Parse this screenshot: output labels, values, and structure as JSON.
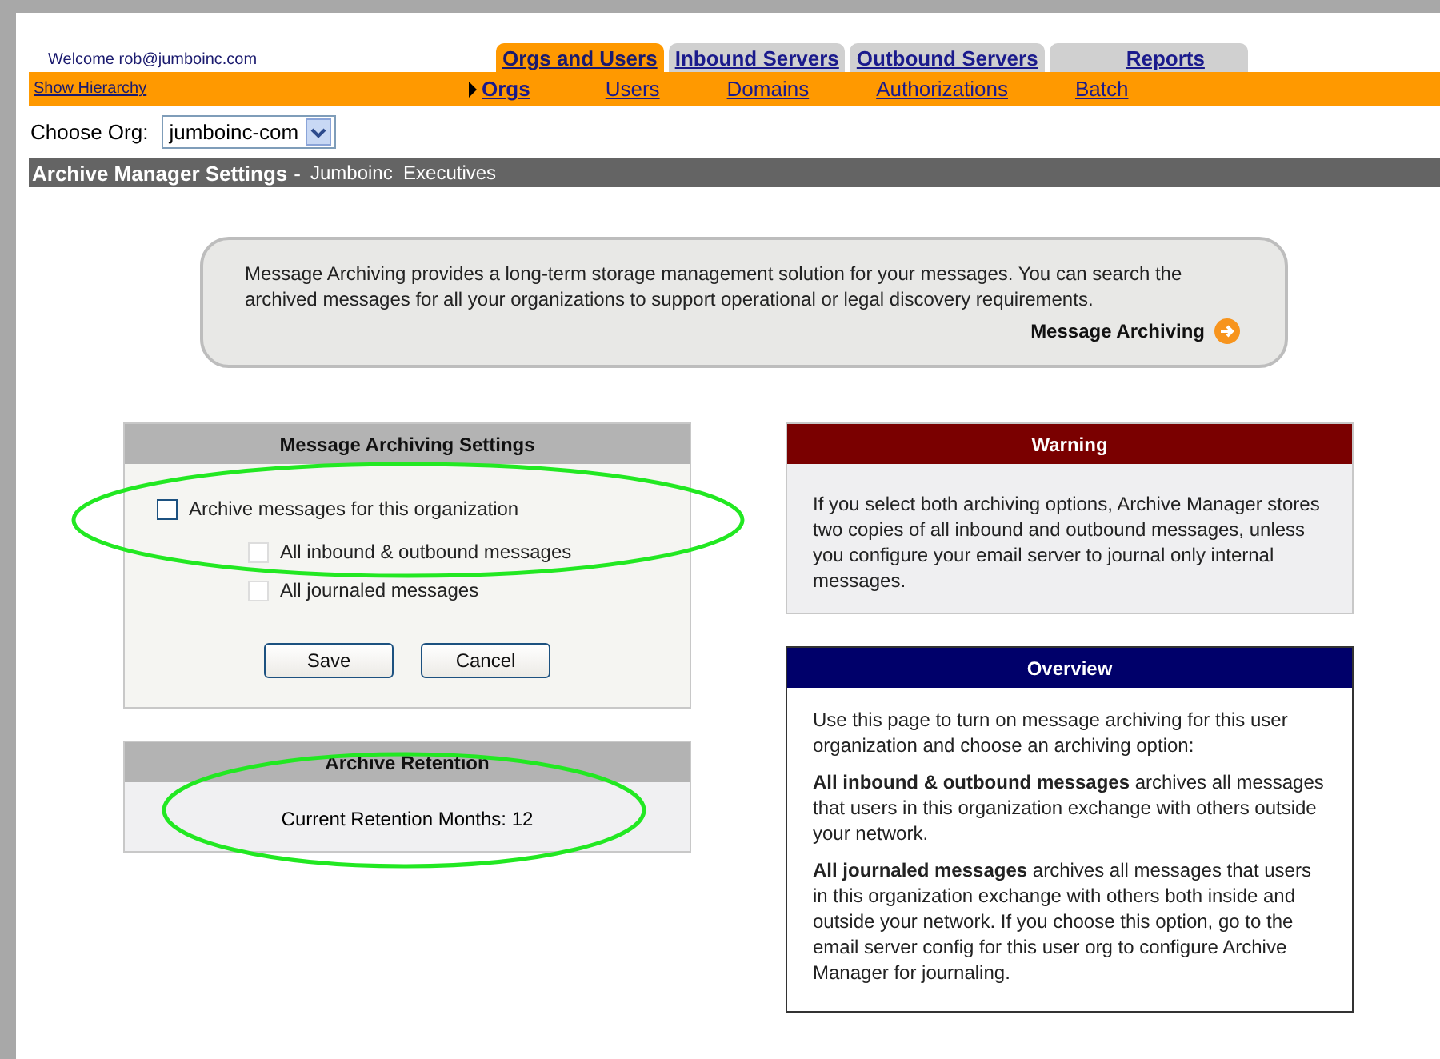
{
  "header": {
    "welcome": "Welcome rob@jumboinc.com",
    "show_hierarchy": "Show Hierarchy"
  },
  "tabs": [
    {
      "label": "Orgs and Users",
      "selected": true
    },
    {
      "label": "Inbound Servers",
      "selected": false
    },
    {
      "label": "Outbound Servers",
      "selected": false
    },
    {
      "label": "Reports",
      "selected": false
    }
  ],
  "subnav": [
    {
      "label": "Orgs",
      "selected": true
    },
    {
      "label": "Users",
      "selected": false
    },
    {
      "label": "Domains",
      "selected": false
    },
    {
      "label": "Authorizations",
      "selected": false
    },
    {
      "label": "Batch",
      "selected": false
    }
  ],
  "org_chooser": {
    "label": "Choose Org:",
    "value": "jumboinc-com"
  },
  "title_bar": {
    "title": "Archive Manager Settings",
    "separator": "-",
    "org": "Jumboinc  Executives"
  },
  "info": {
    "text": "Message Archiving provides a long-term storage management solution for your messages. You can search the archived messages for all your organizations to support operational or legal discovery requirements.",
    "link": "Message Archiving"
  },
  "settings": {
    "title": "Message Archiving Settings",
    "options": [
      {
        "label": "Archive messages for this organization",
        "checked": false,
        "disabled": false,
        "children": [
          {
            "label": "All inbound & outbound messages",
            "checked": false,
            "disabled": true
          },
          {
            "label": "All journaled messages",
            "checked": false,
            "disabled": true
          }
        ]
      }
    ],
    "buttons": [
      "Save",
      "Cancel"
    ]
  },
  "retention": {
    "title": "Archive Retention",
    "text": "Current Retention Months: 12"
  },
  "warning": {
    "title": "Warning",
    "text": "If you select both archiving options, Archive Manager stores two copies of all inbound and outbound messages, unless you configure your email server to journal only internal messages."
  },
  "overview": {
    "title": "Overview",
    "paragraphs": [
      "Use this page to turn on message archiving for this user organization and choose an archiving option:",
      "**All inbound & outbound messages** archives all messages that users in this organization exchange with others outside your network.",
      "**All journaled messages** archives all messages that users in this organization exchange with others both inside and outside your network. If you choose this option, go to the email server config for this user org to configure Archive Manager for journaling."
    ]
  }
}
